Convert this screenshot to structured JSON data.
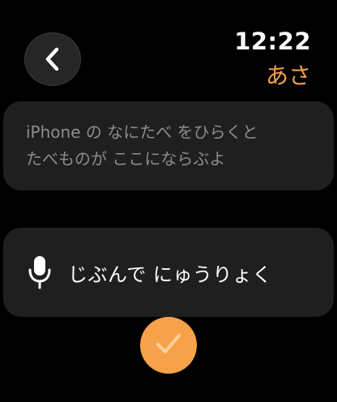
{
  "status": {
    "time": "12:22"
  },
  "header": {
    "title": "あさ",
    "back_icon": "chevron-left-icon"
  },
  "info_card": {
    "text": "iPhone の なにたべ をひらくと\nたべものが ここにならぶよ"
  },
  "dictation": {
    "icon": "microphone-icon",
    "label": "じぶんで にゅうりょく"
  },
  "done": {
    "icon": "checkmark-icon"
  },
  "colors": {
    "accent": "#f7a24a",
    "card_bg": "#1f1f1f",
    "background": "#000000",
    "muted_text": "#8d8d8f"
  }
}
